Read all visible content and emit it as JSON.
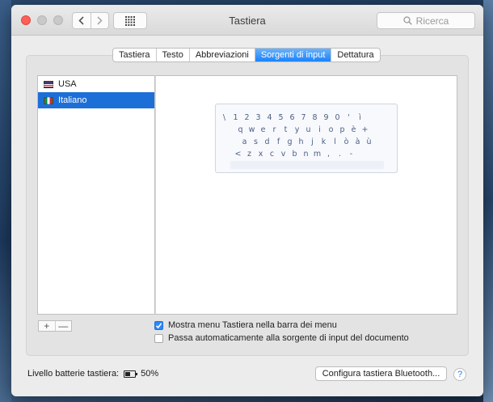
{
  "window": {
    "title": "Tastiera",
    "search_placeholder": "Ricerca"
  },
  "icons": {
    "back": "chevron-left-icon",
    "forward": "chevron-right-icon",
    "grid": "grid-icon",
    "search": "search-icon",
    "battery": "battery-icon",
    "help": "question-icon"
  },
  "tabs": [
    {
      "label": "Tastiera",
      "active": false
    },
    {
      "label": "Testo",
      "active": false
    },
    {
      "label": "Abbreviazioni",
      "active": false
    },
    {
      "label": "Sorgenti di input",
      "active": true
    },
    {
      "label": "Dettatura",
      "active": false
    }
  ],
  "sources": [
    {
      "label": "USA",
      "selected": false
    },
    {
      "label": "Italiano",
      "selected": true
    }
  ],
  "keyboard": {
    "rows": [
      [
        "\\",
        "1",
        "2",
        "3",
        "4",
        "5",
        "6",
        "7",
        "8",
        "9",
        "0",
        "'",
        "ì"
      ],
      [
        "q",
        "w",
        "e",
        "r",
        "t",
        "y",
        "u",
        "i",
        "o",
        "p",
        "è",
        "+"
      ],
      [
        "a",
        "s",
        "d",
        "f",
        "g",
        "h",
        "j",
        "k",
        "l",
        "ò",
        "à",
        "ù"
      ],
      [
        "<",
        "z",
        "x",
        "c",
        "v",
        "b",
        "n",
        "m",
        ",",
        ".",
        "-"
      ]
    ]
  },
  "list_controls": {
    "add": "+",
    "remove": "—"
  },
  "options": {
    "show_menu": {
      "label": "Mostra menu Tastiera nella barra dei menu",
      "checked": true
    },
    "auto_switch": {
      "label": "Passa automaticamente alla sorgente di input del documento",
      "checked": false
    }
  },
  "battery": {
    "label": "Livello batterie tastiera:",
    "value": "50%"
  },
  "bluetooth_button": "Configura tastiera Bluetooth...",
  "help_label": "?",
  "colors": {
    "accent": "#1d6fd8",
    "close": "#fc5f57"
  }
}
